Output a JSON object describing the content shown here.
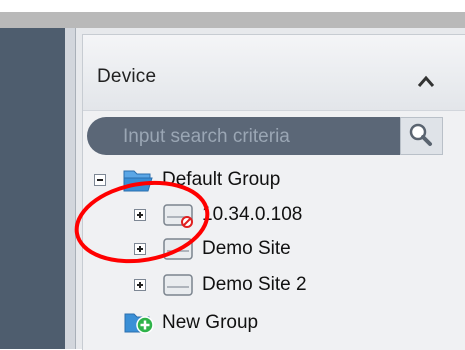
{
  "panel": {
    "title": "Device",
    "collapse_icon": "chevron-up-icon"
  },
  "search": {
    "placeholder": "Input search criteria",
    "icon": "search-icon"
  },
  "tree": {
    "group": {
      "label": "Default Group",
      "expander": "minus",
      "icon": "folder-open-icon"
    },
    "devices": [
      {
        "label": "10.34.0.108",
        "expander": "plus",
        "icon": "device-offline-icon"
      },
      {
        "label": "Demo Site",
        "expander": "plus",
        "icon": "device-icon"
      },
      {
        "label": "Demo Site 2",
        "expander": "plus",
        "icon": "device-icon"
      }
    ],
    "new_group": {
      "label": "New Group",
      "icon": "add-group-icon"
    }
  },
  "colors": {
    "sidebar_dark": "#4e5d6e",
    "search_bg": "#5b6777",
    "folder": "#3a8fd6",
    "offline_badge": "#e02020",
    "add_badge": "#2fb34a",
    "annotation": "#ff0000"
  }
}
